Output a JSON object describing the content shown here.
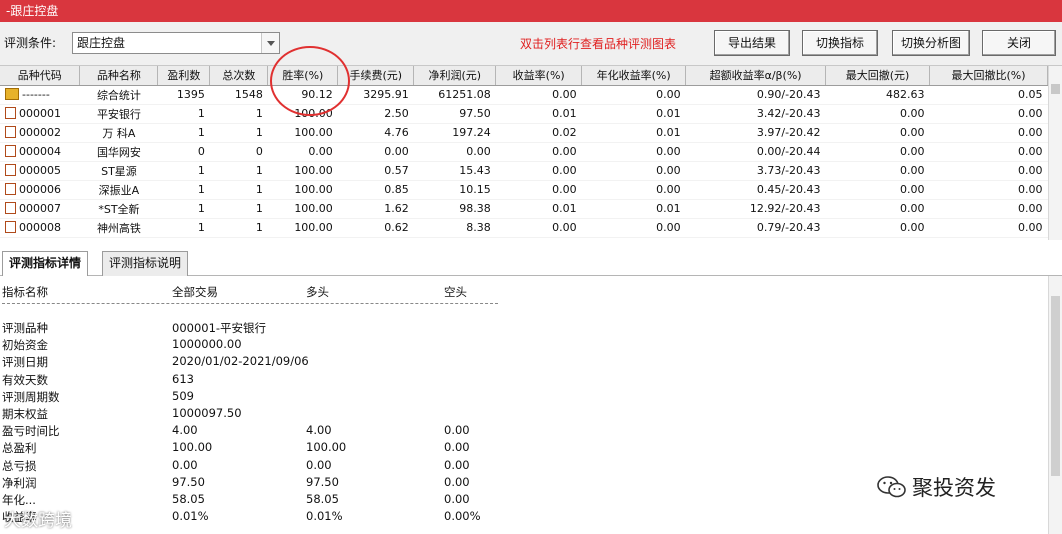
{
  "window": {
    "title": "-跟庄控盘"
  },
  "toolbar": {
    "condition_label": "评测条件:",
    "condition_value": "跟庄控盘",
    "hint": "双击列表行查看品种评测图表",
    "export_label": "导出结果",
    "switch_indicator_label": "切换指标",
    "switch_analysis_label": "切换分析图",
    "close_label": "关闭"
  },
  "grid": {
    "columns": [
      "品种代码",
      "品种名称",
      "盈利数",
      "总次数",
      "胜率(%)",
      "手续费(元)",
      "净利润(元)",
      "收益率(%)",
      "年化收益率(%)",
      "超额收益率α/β(%)",
      "最大回撤(元)",
      "最大回撤比(%)"
    ],
    "rows": [
      {
        "code": "-------",
        "name": "综合统计",
        "win": "1395",
        "total": "1548",
        "rate": "90.12",
        "fee": "3295.91",
        "profit": "61251.08",
        "ret": "0.00",
        "annual": "0.00",
        "excess": "0.90/-20.43",
        "dd": "482.63",
        "ddr": "0.05",
        "summary": true
      },
      {
        "code": "000001",
        "name": "平安银行",
        "win": "1",
        "total": "1",
        "rate": "100.00",
        "fee": "2.50",
        "profit": "97.50",
        "ret": "0.01",
        "annual": "0.01",
        "excess": "3.42/-20.43",
        "dd": "0.00",
        "ddr": "0.00"
      },
      {
        "code": "000002",
        "name": "万 科A",
        "win": "1",
        "total": "1",
        "rate": "100.00",
        "fee": "4.76",
        "profit": "197.24",
        "ret": "0.02",
        "annual": "0.01",
        "excess": "3.97/-20.42",
        "dd": "0.00",
        "ddr": "0.00"
      },
      {
        "code": "000004",
        "name": "国华网安",
        "win": "0",
        "total": "0",
        "rate": "0.00",
        "fee": "0.00",
        "profit": "0.00",
        "ret": "0.00",
        "annual": "0.00",
        "excess": "0.00/-20.44",
        "dd": "0.00",
        "ddr": "0.00"
      },
      {
        "code": "000005",
        "name": "ST星源",
        "win": "1",
        "total": "1",
        "rate": "100.00",
        "fee": "0.57",
        "profit": "15.43",
        "ret": "0.00",
        "annual": "0.00",
        "excess": "3.73/-20.43",
        "dd": "0.00",
        "ddr": "0.00"
      },
      {
        "code": "000006",
        "name": "深振业A",
        "win": "1",
        "total": "1",
        "rate": "100.00",
        "fee": "0.85",
        "profit": "10.15",
        "ret": "0.00",
        "annual": "0.00",
        "excess": "0.45/-20.43",
        "dd": "0.00",
        "ddr": "0.00"
      },
      {
        "code": "000007",
        "name": "*ST全新",
        "win": "1",
        "total": "1",
        "rate": "100.00",
        "fee": "1.62",
        "profit": "98.38",
        "ret": "0.01",
        "annual": "0.01",
        "excess": "12.92/-20.43",
        "dd": "0.00",
        "ddr": "0.00"
      },
      {
        "code": "000008",
        "name": "神州高铁",
        "win": "1",
        "total": "1",
        "rate": "100.00",
        "fee": "0.62",
        "profit": "8.38",
        "ret": "0.00",
        "annual": "0.00",
        "excess": "0.79/-20.43",
        "dd": "0.00",
        "ddr": "0.00"
      }
    ]
  },
  "tabs": [
    {
      "label": "评测指标详情",
      "active": true
    },
    {
      "label": "评测指标说明",
      "active": false
    }
  ],
  "detail": {
    "headers": {
      "name": "指标名称",
      "all": "全部交易",
      "long": "多头",
      "short": "空头"
    },
    "rows": [
      {
        "name": "评测品种",
        "all": "000001-平安银行",
        "long": "",
        "short": ""
      },
      {
        "name": "初始资金",
        "all": "1000000.00",
        "long": "",
        "short": ""
      },
      {
        "name": "评测日期",
        "all": "2020/01/02-2021/09/06",
        "long": "",
        "short": ""
      },
      {
        "name": "有效天数",
        "all": "613",
        "long": "",
        "short": ""
      },
      {
        "name": "评测周期数",
        "all": "509",
        "long": "",
        "short": ""
      },
      {
        "name": "期末权益",
        "all": "1000097.50",
        "long": "",
        "short": ""
      },
      {
        "name": "盈亏时间比",
        "all": "4.00",
        "long": "4.00",
        "short": "0.00"
      },
      {
        "name": "总盈利",
        "all": "100.00",
        "long": "100.00",
        "short": "0.00"
      },
      {
        "name": "总亏损",
        "all": "0.00",
        "long": "0.00",
        "short": "0.00"
      },
      {
        "name": "净利润",
        "all": "97.50",
        "long": "97.50",
        "short": "0.00"
      },
      {
        "name": "年化...",
        "all": "58.05",
        "long": "58.05",
        "short": "0.00"
      },
      {
        "name": "收益率",
        "all": "0.01%",
        "long": "0.01%",
        "short": "0.00%"
      }
    ]
  },
  "watermarks": {
    "right": "聚投资发",
    "left": "大数跨境"
  },
  "colors": {
    "title_bar": "#d9363e",
    "hint": "#e02020",
    "annotation_circle": "#e03030"
  }
}
